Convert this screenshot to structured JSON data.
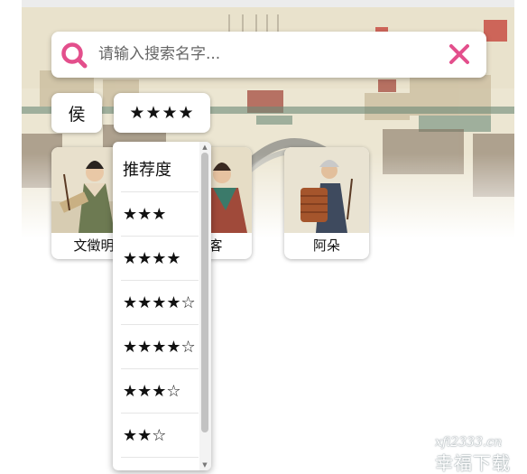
{
  "search": {
    "placeholder": "请输入搜索名字...",
    "search_icon": "search-icon",
    "clear_icon": "close-icon",
    "accent_color": "#e34f8c"
  },
  "filters": {
    "name_filter": "侯",
    "rating_filter": "★★★★"
  },
  "cards": [
    {
      "name": "文徵明"
    },
    {
      "name": "侠客"
    },
    {
      "name": "阿朵"
    }
  ],
  "dropdown": {
    "options": [
      "推荐度",
      "★★★",
      "★★★★",
      "★★★★☆",
      "★★★★☆",
      "★★★☆",
      "★★☆"
    ]
  },
  "watermark": {
    "site": "xfi2333.cn",
    "text": "幸福下载"
  }
}
